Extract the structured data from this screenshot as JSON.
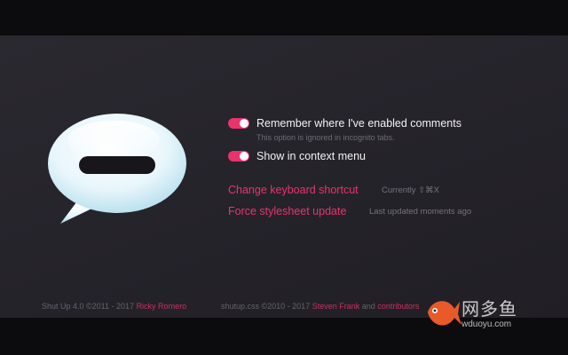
{
  "options": [
    {
      "label": "Remember where I've enabled comments",
      "enabled": true,
      "hint": "This option is ignored in incognito tabs."
    },
    {
      "label": "Show in context menu",
      "enabled": true
    }
  ],
  "actions": {
    "shortcut_label": "Change keyboard shortcut",
    "shortcut_value": "Currently ⇧⌘X",
    "stylesheet_label": "Force stylesheet update",
    "stylesheet_status": "Last updated moments ago"
  },
  "footer": {
    "left_prefix": "Shut Up 4.0 ©2011 - 2017",
    "left_author": "Ricky Romero",
    "right_prefix": "shutup.css ©2010 - 2017",
    "right_author": "Steven Frank",
    "right_and": "and",
    "right_contrib": "contributors"
  },
  "watermark": {
    "name": "网多鱼",
    "url": "wduoyu.com"
  },
  "colors": {
    "accent": "#e8346b",
    "background": "#27252b",
    "text": "#f2f2f4"
  },
  "icons": {
    "app": "speech-bubble-icon",
    "watermark": "fish-logo-icon"
  }
}
